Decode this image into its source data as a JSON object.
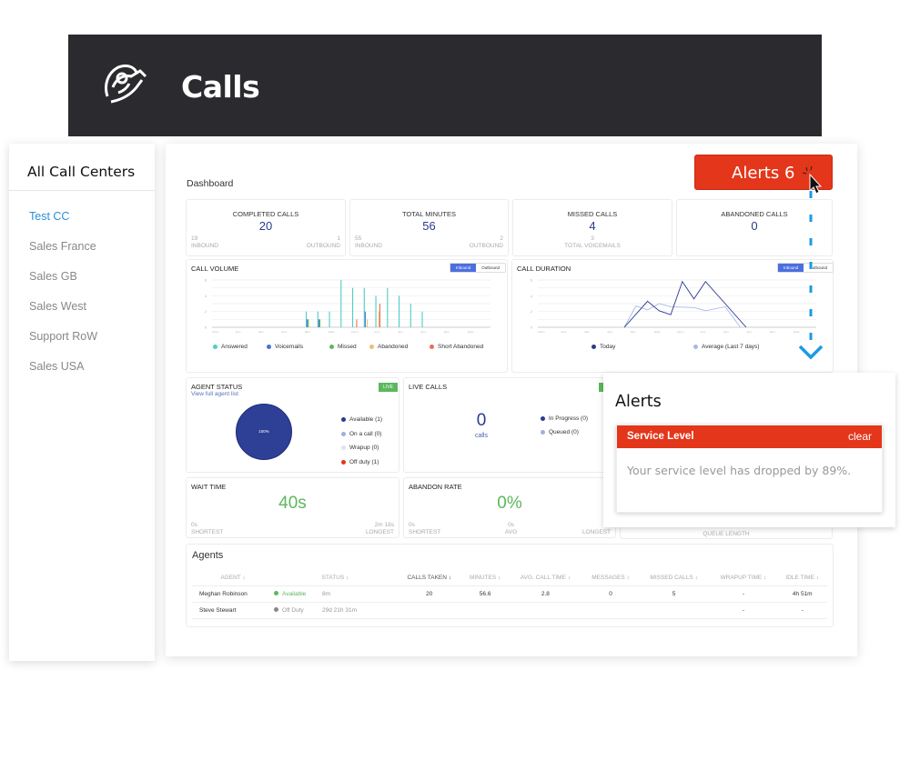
{
  "app": {
    "title": "Calls"
  },
  "sidebar": {
    "title": "All Call Centers",
    "items": [
      {
        "label": "Test CC",
        "active": true
      },
      {
        "label": "Sales France"
      },
      {
        "label": "Sales GB"
      },
      {
        "label": "Sales West"
      },
      {
        "label": "Support RoW"
      },
      {
        "label": "Sales USA"
      }
    ]
  },
  "dashboard": {
    "title": "Dashboard",
    "alerts_button": "Alerts 6"
  },
  "stats": [
    {
      "label": "COMPLETED CALLS",
      "value": "20",
      "left_num": "19",
      "left_lbl": "INBOUND",
      "right_num": "1",
      "right_lbl": "OUTBOUND"
    },
    {
      "label": "TOTAL MINUTES",
      "value": "56",
      "left_num": "55",
      "left_lbl": "INBOUND",
      "right_num": "2",
      "right_lbl": "OUTBOUND"
    },
    {
      "label": "MISSED CALLS",
      "value": "4",
      "center_num": "3",
      "center_lbl": "TOTAL VOICEMAILS"
    },
    {
      "label": "ABANDONED CALLS",
      "value": "0"
    }
  ],
  "toggle": {
    "inbound": "Inbound",
    "outbound": "Outbound"
  },
  "chart_data": [
    {
      "type": "bar",
      "title": "CALL VOLUME",
      "ylim": [
        0,
        6
      ],
      "yticks": [
        "0",
        "2",
        "4",
        "6"
      ],
      "grid": true,
      "xticks": [
        "12am",
        "2am",
        "4am",
        "6am",
        "8am",
        "10am",
        "12pm",
        "2pm",
        "4pm",
        "6pm",
        "8pm",
        "10pm"
      ],
      "hours": [
        8,
        9,
        10,
        11,
        12,
        13,
        14,
        15,
        16,
        17,
        18
      ],
      "legend_placement": "bottom",
      "series": [
        {
          "name": "Answered",
          "color": "#4ecdc4",
          "values": [
            2,
            2,
            2,
            6,
            5,
            5,
            4,
            5,
            4,
            3,
            2
          ]
        },
        {
          "name": "Voicemails",
          "color": "#4c6fe0",
          "values": [
            1,
            1,
            0,
            0,
            0,
            2,
            0,
            0,
            0,
            0,
            0
          ]
        },
        {
          "name": "Missed",
          "color": "#5cb85c",
          "values": [
            1,
            1,
            0,
            0,
            0,
            0,
            0,
            0,
            0,
            0,
            0
          ]
        },
        {
          "name": "Abandoned",
          "color": "#e8c07a",
          "values": [
            0,
            0,
            0,
            0,
            0,
            1,
            2,
            0,
            0,
            0,
            0
          ]
        },
        {
          "name": "Short Abandoned",
          "color": "#f06b55",
          "values": [
            0,
            0,
            0,
            0,
            1,
            0,
            3,
            0,
            0,
            0,
            0
          ]
        }
      ]
    },
    {
      "type": "line",
      "title": "CALL DURATION",
      "ylim": [
        0,
        6
      ],
      "yticks": [
        "0",
        "2",
        "4",
        "6"
      ],
      "grid": true,
      "xticks": [
        "12am",
        "2am",
        "4am",
        "6am",
        "8am",
        "10am",
        "12pm",
        "2pm",
        "4pm",
        "6pm",
        "8pm",
        "10pm"
      ],
      "legend_placement": "bottom",
      "series": [
        {
          "name": "Today",
          "color": "#2a3a8f",
          "x": [
            7.3,
            9.3,
            10.3,
            11.3,
            12.3,
            13.3,
            14.3,
            17.8
          ],
          "values": [
            0,
            3.3,
            2.1,
            1.6,
            5.8,
            3.6,
            5.8,
            0
          ]
        },
        {
          "name": "Average (Last 7 days)",
          "color": "#a9b8e8",
          "x": [
            7.3,
            8.3,
            9.3,
            10.3,
            11.3,
            13.3,
            14.3,
            16,
            17.3
          ],
          "values": [
            0,
            2.7,
            2.2,
            3.0,
            2.6,
            2.5,
            2.1,
            2.6,
            0
          ]
        }
      ]
    }
  ],
  "agent_status": {
    "title": "AGENT STATUS",
    "link": "View full agent list",
    "live": "LIVE",
    "pie_label": "100%",
    "legend": [
      {
        "label": "Available (1)",
        "color": "#2a3a8f"
      },
      {
        "label": "On a call (0)",
        "color": "#9fb0e0"
      },
      {
        "label": "Wrapup (0)",
        "color": "#dfe3f3"
      },
      {
        "label": "Off duty (1)",
        "color": "#e4361a"
      }
    ]
  },
  "live_calls": {
    "title": "LIVE CALLS",
    "live": "LIVE",
    "value": "0",
    "unit": "calls",
    "legend": [
      {
        "label": "In Progress (0)",
        "color": "#2a3a8f"
      },
      {
        "label": "Queued (0)",
        "color": "#9fb0e0"
      }
    ]
  },
  "wait_time": {
    "title": "WAIT TIME",
    "value": "40s",
    "shortest": "0s",
    "shortest_lbl": "SHORTEST",
    "longest": "2m 18s",
    "longest_lbl": "LONGEST"
  },
  "abandon_rate": {
    "title": "ABANDON RATE",
    "value": "0%",
    "shortest": "0s",
    "shortest_lbl": "SHORTEST",
    "avg": "0s",
    "avg_lbl": "AVG",
    "longest_lbl": "LONGEST"
  },
  "queue": {
    "label": "QUEUE LENGTH"
  },
  "agents": {
    "title": "Agents",
    "columns": [
      "AGENT",
      "STATUS",
      "CALLS TAKEN",
      "MINUTES",
      "AVG. CALL TIME",
      "MESSAGES",
      "MISSED CALLS",
      "WRAPUP TIME",
      "IDLE TIME"
    ],
    "rows": [
      {
        "agent": "Meghan Robinson",
        "status": "Available",
        "status_color": "#5cb85c",
        "duration": "8m",
        "calls": "20",
        "minutes": "56.6",
        "avg": "2.8",
        "messages": "0",
        "missed": "5",
        "wrapup": "-",
        "idle": "4h 51m"
      },
      {
        "agent": "Steve Stewart",
        "status": "Off Duty",
        "status_color": "#888888",
        "duration": "29d 21h 31m",
        "calls": "",
        "minutes": "",
        "avg": "",
        "messages": "",
        "missed": "",
        "wrapup": "-",
        "idle": "-"
      }
    ]
  },
  "alerts_popup": {
    "title": "Alerts",
    "item_title": "Service Level",
    "clear": "clear",
    "message": "Your service level has dropped by 89%."
  },
  "colors": {
    "accent_red": "#e4361a",
    "header": "#2b2b2f",
    "link_blue": "#2b8fd6",
    "dashed_indicator": "#1a9be6"
  }
}
